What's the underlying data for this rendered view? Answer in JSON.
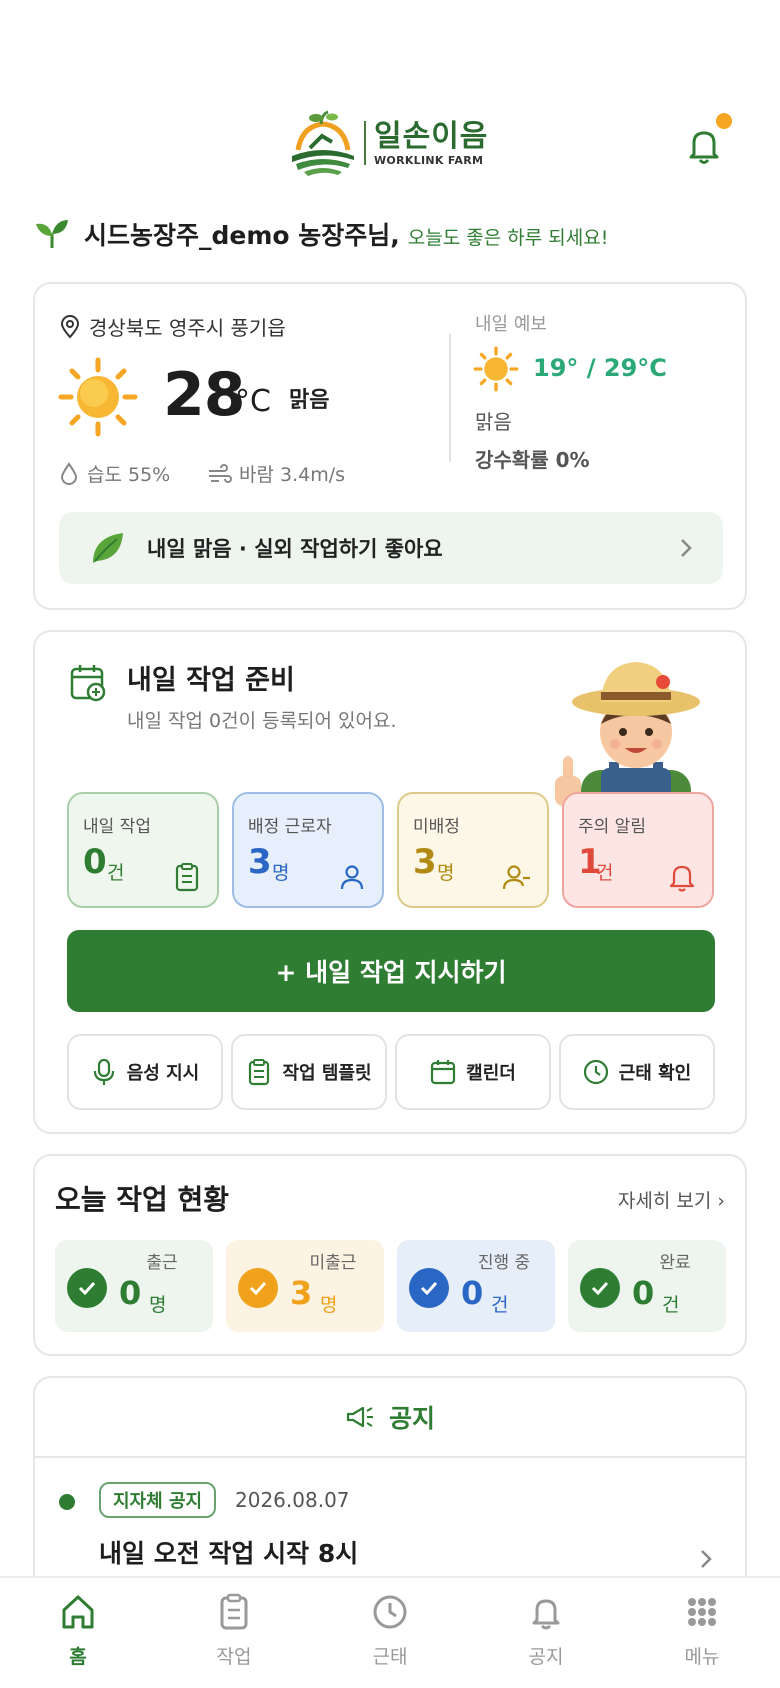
{
  "brand": {
    "name_ko": "일손이음",
    "name_en": "WORKLINK FARM"
  },
  "greeting": {
    "name": "시드농장주_demo 농장주님,",
    "message": "오늘도 좋은 하루 되세요!"
  },
  "weather": {
    "location": "경상북도 영주시 풍기읍",
    "temp": "28",
    "unit": "°C",
    "condition": "맑음",
    "humidity": "습도 55%",
    "wind": "바람 3.4m/s",
    "tomorrow": {
      "label": "내일 예보",
      "temp": "19° / 29°C",
      "condition": "맑음",
      "rain": "강수확률 0%"
    },
    "tip": "내일 맑음 · 실외 작업하기 좋아요"
  },
  "prep": {
    "title": "내일 작업 준비",
    "subtitle": "내일 작업 0건이 등록되어 있어요.",
    "stats": [
      {
        "label": "내일 작업",
        "value": "0",
        "unit": "건",
        "color": "#2e7d32",
        "icon": "clipboard-icon"
      },
      {
        "label": "배정 근로자",
        "value": "3",
        "unit": "명",
        "color": "#2a67c4",
        "icon": "person-icon"
      },
      {
        "label": "미배정",
        "value": "3",
        "unit": "명",
        "color": "#b08a12",
        "icon": "person-minus-icon"
      },
      {
        "label": "주의 알림",
        "value": "1",
        "unit": "건",
        "color": "#e04a3c",
        "icon": "bell-icon"
      }
    ],
    "cta": "+ 내일 작업 지시하기",
    "actions": [
      "음성 지시",
      "작업 템플릿",
      "캘린더",
      "근태 확인"
    ]
  },
  "today": {
    "title": "오늘 작업 현황",
    "more": "자세히 보기 ›",
    "items": [
      {
        "label": "출근",
        "value": "0",
        "unit": "명",
        "color": "#2e7d32"
      },
      {
        "label": "미출근",
        "value": "3",
        "unit": "명",
        "color": "#f0a21c"
      },
      {
        "label": "진행 중",
        "value": "0",
        "unit": "건",
        "color": "#2a67c4"
      },
      {
        "label": "완료",
        "value": "0",
        "unit": "건",
        "color": "#2e7d32"
      }
    ]
  },
  "notice": {
    "title": "공지",
    "badge": "지자체 공지",
    "date": "2026.08.07",
    "headline": "내일 오전 작업 시작 8시"
  },
  "tabs": [
    "홈",
    "작업",
    "근태",
    "공지",
    "메뉴"
  ],
  "colors": {
    "primary": "#2e7d32",
    "accent": "#f5a623"
  }
}
